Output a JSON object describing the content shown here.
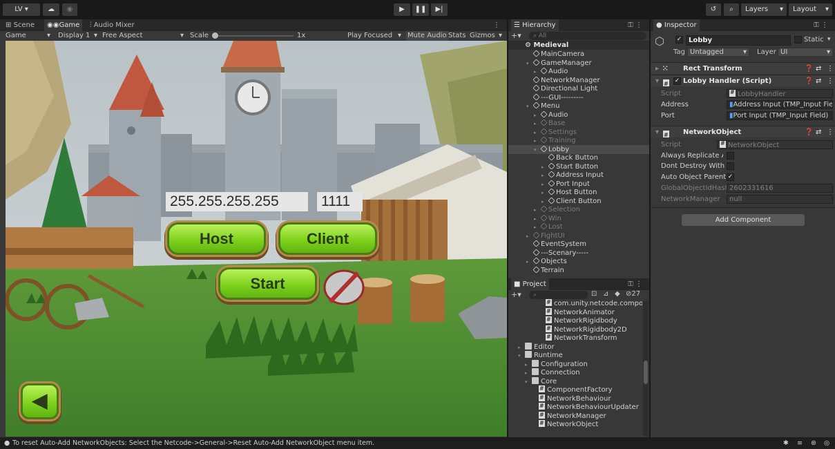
{
  "toolbar": {
    "account_label": "LV ▾",
    "play_icon": "play-icon",
    "pause_icon": "pause-icon",
    "step_icon": "step-icon",
    "layers_label": "Layers",
    "layout_label": "Layout"
  },
  "game_panel": {
    "tabs": [
      "Scene",
      "Game",
      "Audio Mixer"
    ],
    "view_mode": "Game",
    "display": "Display 1",
    "aspect": "Free Aspect",
    "scale_label": "Scale",
    "scale_value": "1x",
    "play_focused": "Play Focused",
    "mute_audio": "Mute Audio",
    "stats": "Stats",
    "gizmos": "Gizmos"
  },
  "game_ui": {
    "address_value": "255.255.255.255",
    "port_value": "1111",
    "host_label": "Host",
    "client_label": "Client",
    "start_label": "Start"
  },
  "hierarchy": {
    "title": "Hierarchy",
    "search_placeholder": "All",
    "scene_name": "Medieval",
    "items": [
      {
        "label": "MainCamera",
        "state": "normal"
      },
      {
        "label": "GameManager",
        "state": "normal"
      },
      {
        "label": "Audio",
        "state": "normal"
      },
      {
        "label": "NetworkManager",
        "state": "normal"
      },
      {
        "label": "Directional Light",
        "state": "normal"
      },
      {
        "label": "---GUI---------",
        "state": "normal"
      },
      {
        "label": "Menu",
        "state": "normal"
      },
      {
        "label": "Audio",
        "state": "normal"
      },
      {
        "label": "Base",
        "state": "dim"
      },
      {
        "label": "Settings",
        "state": "dim"
      },
      {
        "label": "Training",
        "state": "dim"
      },
      {
        "label": "Lobby",
        "state": "selected"
      },
      {
        "label": "Back Button",
        "state": "normal"
      },
      {
        "label": "Start Button",
        "state": "normal"
      },
      {
        "label": "Address Input",
        "state": "normal"
      },
      {
        "label": "Port Input",
        "state": "normal"
      },
      {
        "label": "Host Button",
        "state": "normal"
      },
      {
        "label": "Client Button",
        "state": "normal"
      },
      {
        "label": "Selection",
        "state": "dim"
      },
      {
        "label": "Win",
        "state": "dim"
      },
      {
        "label": "Lost",
        "state": "dim"
      },
      {
        "label": "FightUI",
        "state": "dim"
      },
      {
        "label": "EventSystem",
        "state": "normal"
      },
      {
        "label": "---Scenary-----",
        "state": "normal"
      },
      {
        "label": "Objects",
        "state": "normal"
      },
      {
        "label": "Terrain",
        "state": "normal"
      }
    ]
  },
  "project": {
    "title": "Project",
    "hidden_count": "27",
    "items": [
      {
        "label": "com.unity.netcode.components",
        "kind": "script"
      },
      {
        "label": "NetworkAnimator",
        "kind": "script"
      },
      {
        "label": "NetworkRigidbody",
        "kind": "script"
      },
      {
        "label": "NetworkRigidbody2D",
        "kind": "script"
      },
      {
        "label": "NetworkTransform",
        "kind": "script"
      },
      {
        "label": "Editor",
        "kind": "folder"
      },
      {
        "label": "Runtime",
        "kind": "folder"
      },
      {
        "label": "Configuration",
        "kind": "folder"
      },
      {
        "label": "Connection",
        "kind": "folder"
      },
      {
        "label": "Core",
        "kind": "folder"
      },
      {
        "label": "ComponentFactory",
        "kind": "script"
      },
      {
        "label": "NetworkBehaviour",
        "kind": "script"
      },
      {
        "label": "NetworkBehaviourUpdater",
        "kind": "script"
      },
      {
        "label": "NetworkManager",
        "kind": "script"
      },
      {
        "label": "NetworkObject",
        "kind": "script"
      }
    ]
  },
  "inspector": {
    "title": "Inspector",
    "object_name": "Lobby",
    "static_label": "Static",
    "tag_label": "Tag",
    "tag_value": "Untagged",
    "layer_label": "Layer",
    "layer_value": "UI",
    "rect_transform": "Rect Transform",
    "lobby_handler": {
      "title": "Lobby Handler (Script)",
      "script_label": "Script",
      "script_value": "LobbyHandler",
      "address_label": "Address",
      "address_value": "Address Input (TMP_Input Fie",
      "port_label": "Port",
      "port_value": "Port Input (TMP_Input Field)"
    },
    "network_object": {
      "title": "NetworkObject",
      "script_label": "Script",
      "script_value": "NetworkObject",
      "always_replicate": "Always Replicate As",
      "dont_destroy": "Dont Destroy With Ov",
      "auto_parent": "Auto Object Parent S",
      "hash_label": "GlobalObjectIdHash",
      "hash_value": "2602331616",
      "manager_label": "NetworkManager",
      "manager_value": "null"
    },
    "add_component": "Add Component"
  },
  "status_bar": {
    "message": "To reset Auto-Add NetworkObjects: Select the Netcode->General->Reset Auto-Add NetworkObject menu item."
  },
  "colors": {
    "button_green": "#8ad827",
    "wood_border": "#b98a4a",
    "editor_bg": "#383838"
  }
}
